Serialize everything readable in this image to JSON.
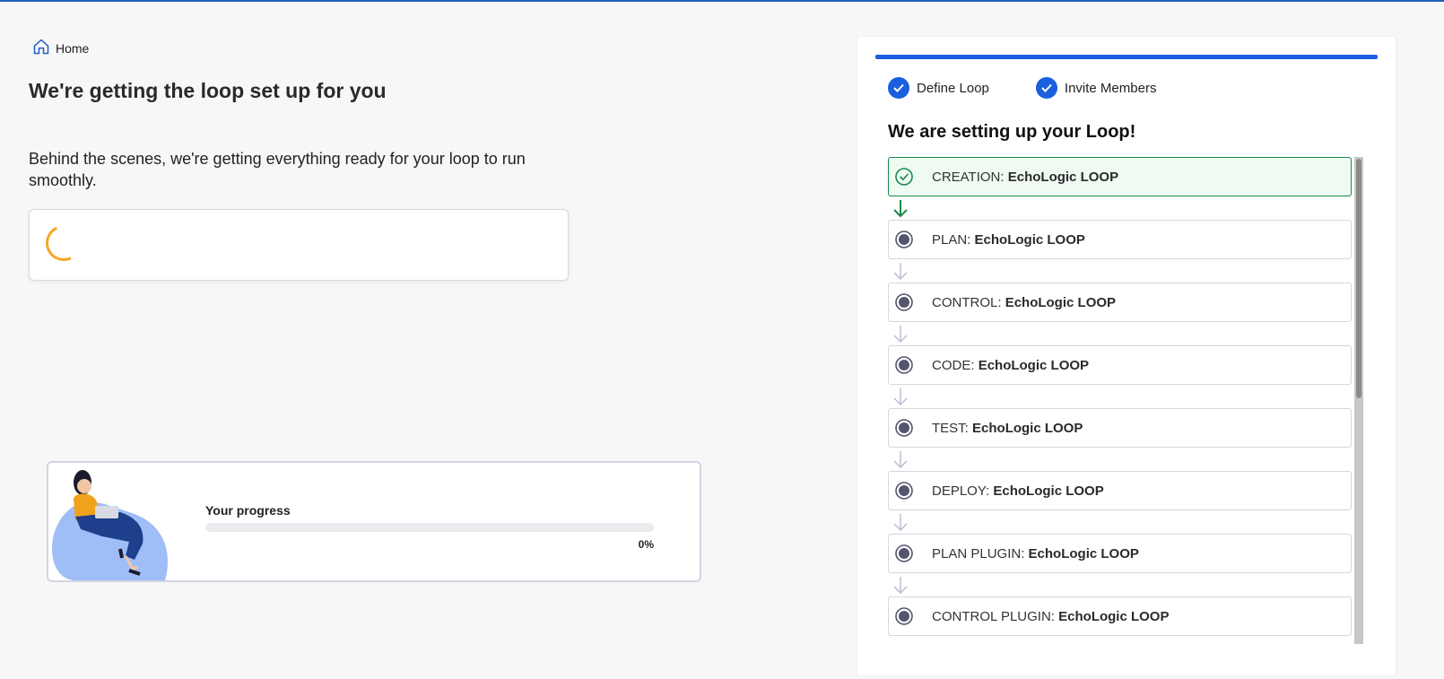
{
  "breadcrumb": {
    "home_label": "Home"
  },
  "page": {
    "title": "We're getting the loop set up for you",
    "subtitle": "Behind the scenes, we're getting everything ready for your loop to run smoothly."
  },
  "progress": {
    "label": "Your progress",
    "value_percent": 0,
    "value_text": "0%"
  },
  "panel": {
    "steps": [
      {
        "label": "Define Loop",
        "completed": true
      },
      {
        "label": "Invite Members",
        "completed": true
      }
    ],
    "title": "We are setting up your Loop!",
    "stages": [
      {
        "prefix": "CREATION: ",
        "name": "EchoLogic LOOP",
        "status": "done"
      },
      {
        "prefix": "PLAN: ",
        "name": "EchoLogic LOOP",
        "status": "pending"
      },
      {
        "prefix": "CONTROL: ",
        "name": "EchoLogic LOOP",
        "status": "pending"
      },
      {
        "prefix": "CODE: ",
        "name": "EchoLogic LOOP",
        "status": "pending"
      },
      {
        "prefix": "TEST: ",
        "name": "EchoLogic LOOP",
        "status": "pending"
      },
      {
        "prefix": "DEPLOY: ",
        "name": "EchoLogic LOOP",
        "status": "pending"
      },
      {
        "prefix": "PLAN PLUGIN: ",
        "name": "EchoLogic LOOP",
        "status": "pending"
      },
      {
        "prefix": "CONTROL PLUGIN: ",
        "name": "EchoLogic LOOP",
        "status": "pending"
      }
    ]
  },
  "colors": {
    "accent": "#1a5fe0",
    "success": "#1a8a4a",
    "spinner": "#f5a623",
    "pending_icon": "#55556e"
  },
  "icons": {
    "home": "home-icon",
    "step_check": "check-icon",
    "done": "check-circle-icon",
    "pending": "radio-dot-icon",
    "arrow": "arrow-down-icon"
  }
}
